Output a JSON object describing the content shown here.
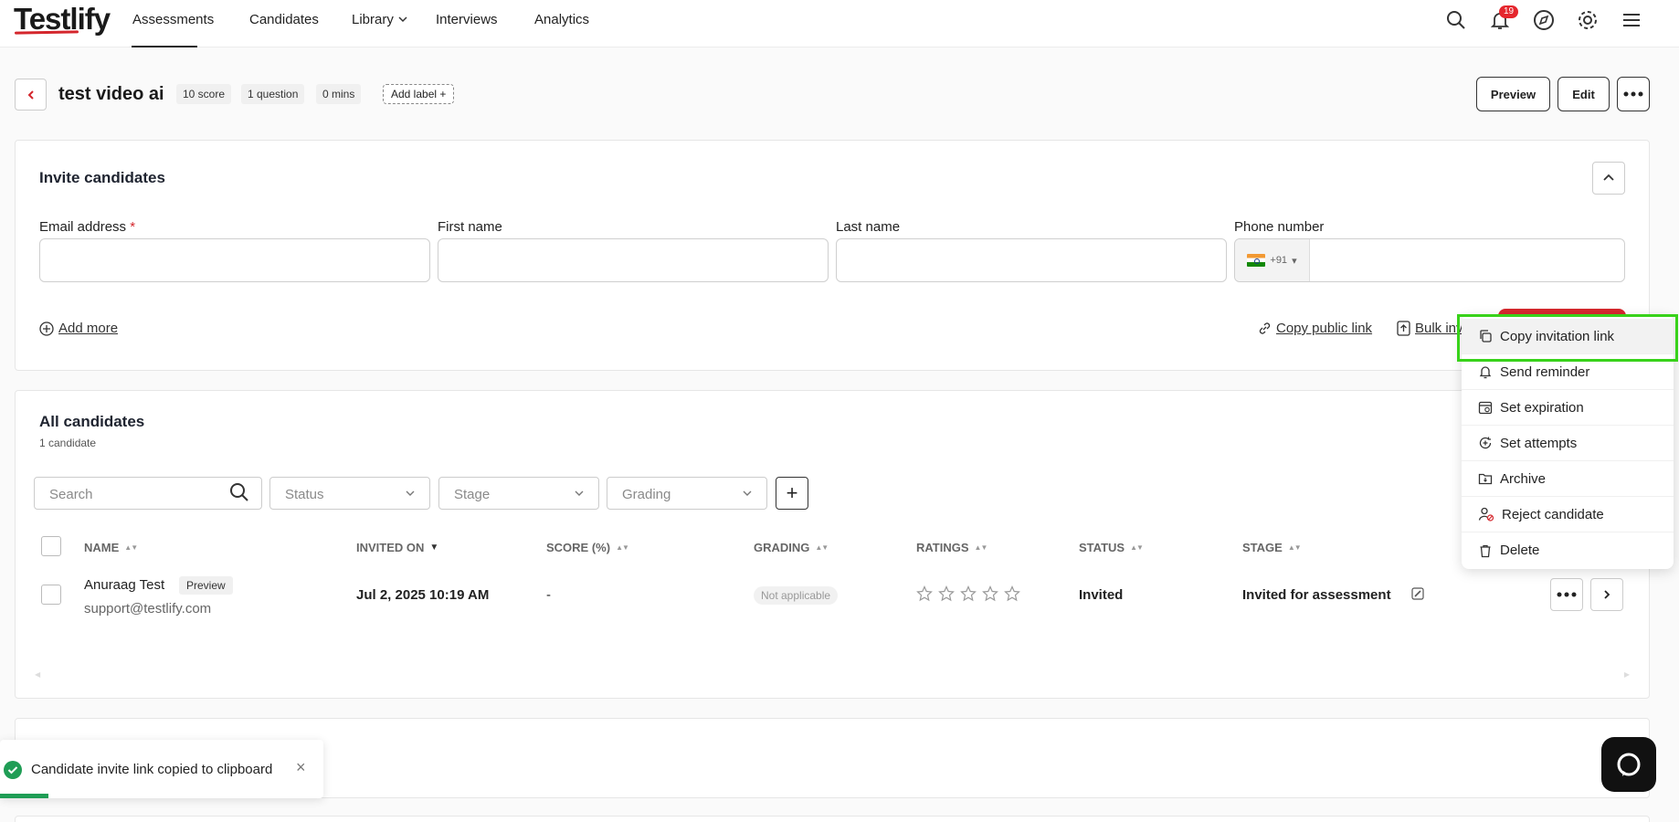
{
  "app": {
    "logo": "Testlify"
  },
  "nav": {
    "items": [
      "Assessments",
      "Candidates",
      "Library",
      "Interviews",
      "Analytics"
    ],
    "notification_count": "19"
  },
  "assessment": {
    "title": "test video ai",
    "chips": [
      "10 score",
      "1 question",
      "0 mins"
    ],
    "add_label": "Add label",
    "preview": "Preview",
    "edit": "Edit"
  },
  "invite": {
    "title": "Invite candidates",
    "email_label": "Email address",
    "required_mark": "*",
    "first_name_label": "First name",
    "last_name_label": "Last name",
    "phone_label": "Phone number",
    "country_code": "+91",
    "add_more": "Add more",
    "copy_public_link": "Copy public link",
    "bulk_invite": "Bulk inv"
  },
  "candidates": {
    "title": "All candidates",
    "count": "1 candidate",
    "search_placeholder": "Search",
    "filters": [
      "Status",
      "Stage",
      "Grading"
    ],
    "columns": [
      "NAME",
      "INVITED ON",
      "SCORE (%)",
      "GRADING",
      "RATINGS",
      "STATUS",
      "STAGE"
    ],
    "rows": [
      {
        "name": "Anuraag Test",
        "preview": "Preview",
        "email": "support@testlify.com",
        "invited_on": "Jul 2, 2025 10:19 AM",
        "score": "-",
        "grading": "Not applicable",
        "rating_stars": 0,
        "status": "Invited",
        "stage": "Invited for assessment"
      }
    ]
  },
  "menu": {
    "items": [
      "Copy invitation link",
      "Send reminder",
      "Set expiration",
      "Set attempts",
      "Archive",
      "Reject candidate",
      "Delete"
    ]
  },
  "toast": {
    "message": "Candidate invite link copied to clipboard",
    "progress": 0.15
  },
  "colors": {
    "brand_red": "#d4262c",
    "success_green": "#1f9d55",
    "highlight_green": "#38d21a"
  }
}
